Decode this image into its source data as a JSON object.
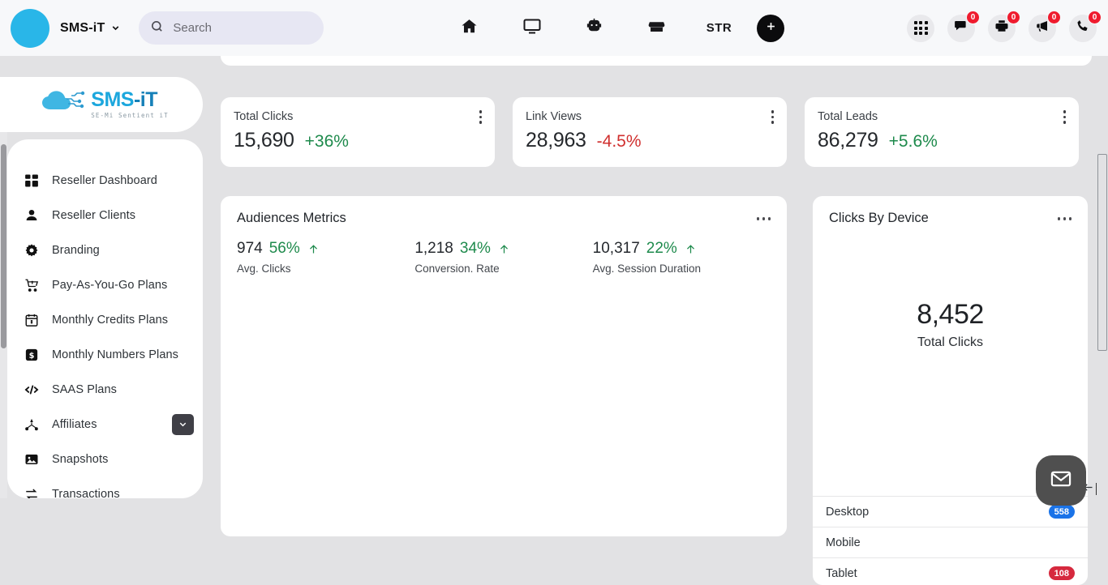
{
  "header": {
    "brand_name": "SMS-iT",
    "brand_caret_icon": "chevron-down-icon",
    "search": {
      "placeholder": "Search",
      "value": "",
      "icon": "search-icon"
    },
    "nav_items": [
      {
        "name": "home",
        "icon": "home-icon",
        "label": ""
      },
      {
        "name": "display",
        "icon": "monitor-icon",
        "label": ""
      },
      {
        "name": "bot",
        "icon": "robot-icon",
        "label": ""
      },
      {
        "name": "store",
        "icon": "store-icon",
        "label": ""
      },
      {
        "name": "str",
        "icon": "text-icon",
        "label": "STR"
      }
    ],
    "add_button": {
      "label": "+",
      "icon": "plus-icon"
    },
    "right_items": [
      {
        "name": "apps",
        "icon": "grid-apps-icon",
        "badge": ""
      },
      {
        "name": "messages",
        "icon": "chat-bubble-icon",
        "badge": "0"
      },
      {
        "name": "fax",
        "icon": "printer-icon",
        "badge": "0"
      },
      {
        "name": "announcements",
        "icon": "megaphone-icon",
        "badge": "0"
      },
      {
        "name": "calls",
        "icon": "phone-icon",
        "badge": "0"
      }
    ]
  },
  "logo": {
    "main_a": "SMS",
    "main_b": "-iT",
    "tagline": "SE-Mi Sentient iT"
  },
  "sidebar": {
    "items": [
      {
        "label": "Reseller Dashboard",
        "icon": "dashboard-grid-icon",
        "expandable": false
      },
      {
        "label": "Reseller Clients",
        "icon": "user-icon",
        "expandable": false
      },
      {
        "label": "Branding",
        "icon": "gear-icon",
        "expandable": false
      },
      {
        "label": "Pay-As-You-Go Plans",
        "icon": "cart-icon",
        "expandable": false
      },
      {
        "label": "Monthly Credits Plans",
        "icon": "calendar-money-icon",
        "expandable": false
      },
      {
        "label": "Monthly Numbers Plans",
        "icon": "money-square-icon",
        "expandable": false
      },
      {
        "label": "SAAS Plans",
        "icon": "code-icon",
        "expandable": false
      },
      {
        "label": "Affiliates",
        "icon": "network-icon",
        "expandable": true
      },
      {
        "label": "Snapshots",
        "icon": "image-icon",
        "expandable": false
      },
      {
        "label": "Transactions",
        "icon": "transactions-icon",
        "expandable": false
      }
    ],
    "collapse_icon": "arrow-left-icon",
    "expand_caret_icon": "chevron-down-icon"
  },
  "stats": [
    {
      "title": "Total Clicks",
      "value": "15,690",
      "delta": "+36%",
      "trend": "up"
    },
    {
      "title": "Link Views",
      "value": "28,963",
      "delta": "-4.5%",
      "trend": "down"
    },
    {
      "title": "Total Leads",
      "value": "86,279",
      "delta": "+5.6%",
      "trend": "up"
    }
  ],
  "audiences": {
    "title": "Audiences Metrics",
    "menu_icon": "ellipsis-icon",
    "metrics": [
      {
        "value": "974",
        "percent": "56%",
        "label": "Avg. Clicks",
        "trend": "up"
      },
      {
        "value": "1,218",
        "percent": "34%",
        "label": "Conversion. Rate",
        "trend": "up"
      },
      {
        "value": "10,317",
        "percent": "22%",
        "label": "Avg. Session Duration",
        "trend": "up"
      }
    ]
  },
  "clicks_by_device": {
    "title": "Clicks By Device",
    "menu_icon": "ellipsis-icon",
    "total_value": "8,452",
    "total_label": "Total Clicks",
    "rows": [
      {
        "name": "Desktop",
        "count": "558",
        "color": "#1a73e8"
      },
      {
        "name": "Mobile",
        "count": "",
        "color": "#1a73e8"
      },
      {
        "name": "Tablet",
        "count": "108",
        "color": "#d6293e"
      }
    ]
  },
  "fab": {
    "icon": "envelope-icon",
    "label": ""
  },
  "colors": {
    "brand": "#29b6e8",
    "positive": "#1e8a4c",
    "negative": "#d0302f",
    "badge_red": "#ef1b2e",
    "badge_blue": "#1a73e8",
    "page_bg": "#e2e2e4",
    "topbar_bg": "#f7f8fa"
  }
}
